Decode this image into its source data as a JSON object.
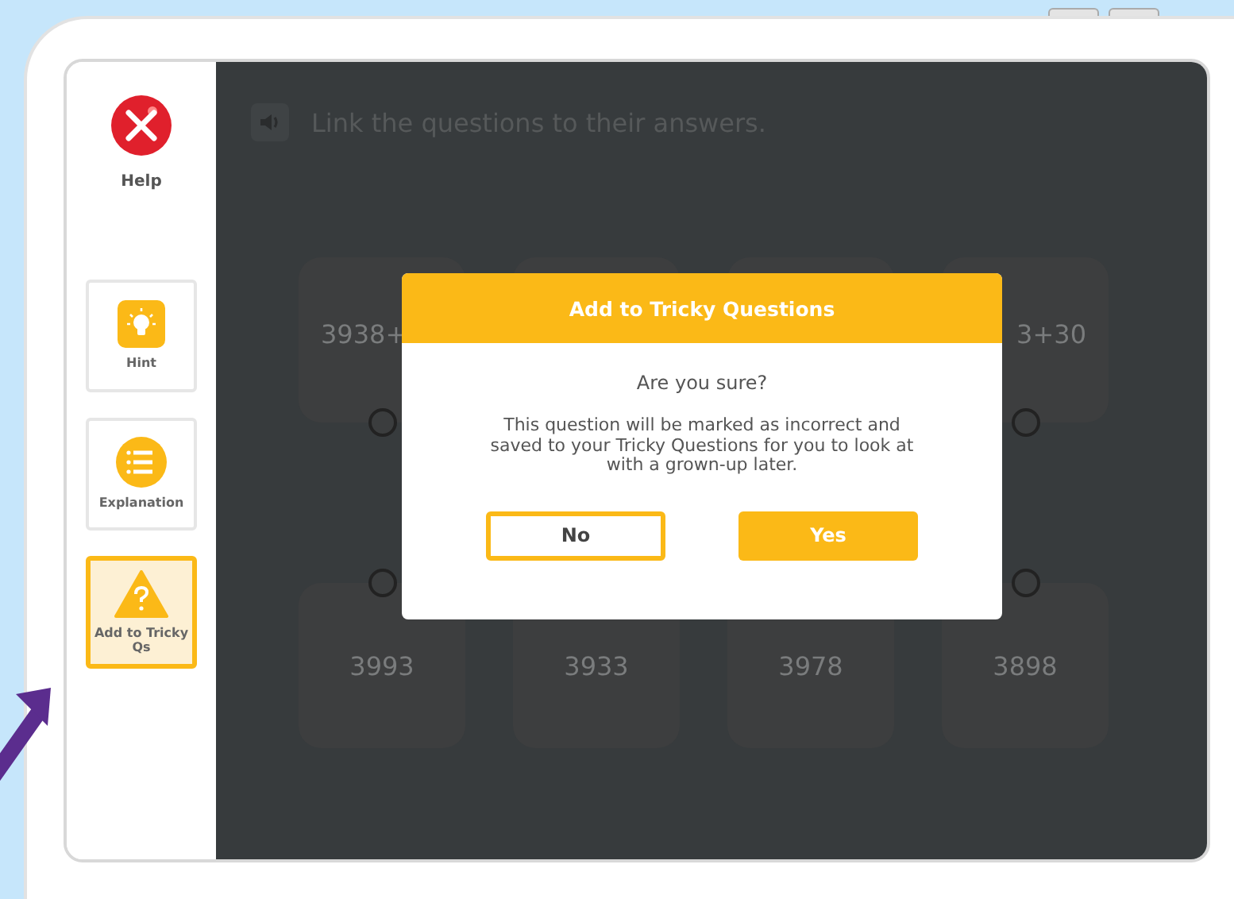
{
  "instruction": "Link the questions to their answers.",
  "sidebar": {
    "help": {
      "label": "Help"
    },
    "tools": [
      {
        "kind": "hint",
        "label": "Hint",
        "selected": false
      },
      {
        "kind": "explanation",
        "label": "Explanation",
        "selected": false
      },
      {
        "kind": "tricky",
        "label": "Add to Tricky Qs",
        "selected": true
      }
    ]
  },
  "questions": [
    "3938+",
    "3+30"
  ],
  "answers": [
    "3993",
    "3933",
    "3978",
    "3898"
  ],
  "dialog": {
    "title": "Add to Tricky Questions",
    "heading": "Are you sure?",
    "message": "This question will be marked as incorrect and saved to your Tricky Questions for you to look at with a grown-up later.",
    "buttons": [
      {
        "kind": "secondary",
        "label": "No"
      },
      {
        "kind": "primary",
        "label": "Yes"
      }
    ]
  }
}
